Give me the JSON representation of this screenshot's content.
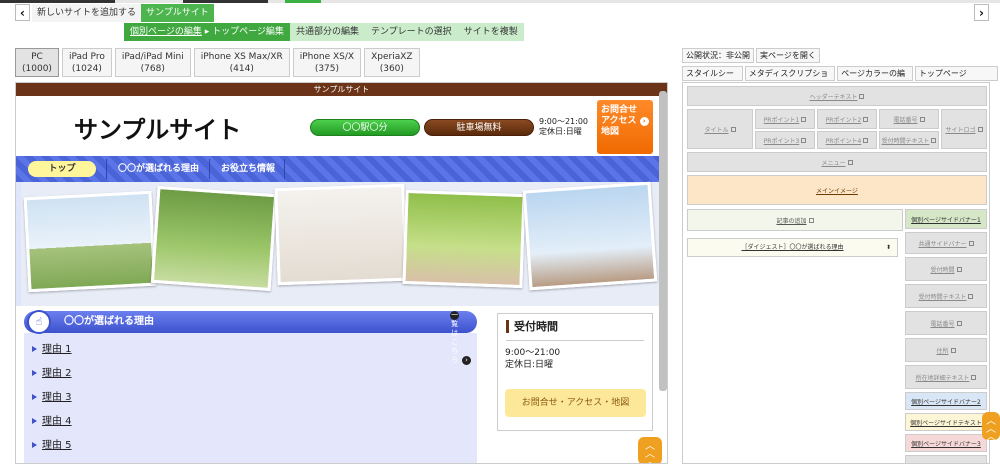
{
  "toolbar": {
    "prev_icon": "chevron-left-icon",
    "next_icon": "chevron-right-icon",
    "add_site": "新しいサイトを追加する",
    "current_site": "サンプルサイト"
  },
  "subnav": {
    "breadcrumb_page_edit": "個別ページの編集",
    "breadcrumb_current": "トップページ編集",
    "items": [
      "共通部分の編集",
      "テンプレートの選択",
      "サイトを複製"
    ]
  },
  "devices": [
    {
      "name": "PC",
      "width": "(1000)"
    },
    {
      "name": "iPad Pro",
      "width": "(1024)"
    },
    {
      "name": "iPad/iPad Mini",
      "width": "(768)"
    },
    {
      "name": "iPhone XS Max/XR",
      "width": "(414)"
    },
    {
      "name": "iPhone XS/X",
      "width": "(375)"
    },
    {
      "name": "XperiaXZ",
      "width": "(360)"
    }
  ],
  "preview": {
    "site_bar": "サンプルサイト",
    "site_title": "サンプルサイト",
    "station_pill": "〇〇駅〇分",
    "parking_pill": "駐車場無料",
    "hours_line1": "9:00〜21:00",
    "hours_line2": "定休日:日曜",
    "contact_line1": "お問合せ",
    "contact_line2": "アクセス",
    "contact_line3": "地図",
    "menu": [
      "トップ",
      "〇〇が選ばれる理由",
      "お役立ち情報"
    ],
    "section_title": "〇〇が選ばれる理由",
    "section_more": "一覧はこちら",
    "reasons": [
      "理由 1",
      "理由 2",
      "理由 3",
      "理由 4",
      "理由 5"
    ],
    "side_title": "受付時間",
    "side_hours1": "9:00〜21:00",
    "side_hours2": "定休日:日曜",
    "side_button": "お問合せ・アクセス・地図",
    "colors": {
      "brand_brown": "#6b3418",
      "menu_blue": "#4a63d6",
      "green": "#3cb043",
      "orange": "#f06a00"
    }
  },
  "right": {
    "status": "公開状況：非公開",
    "open_page": "実ページを開く",
    "tools": [
      "スタイルシート",
      "メタディスクリプション",
      "ページカラーの編集",
      "トップページnoindex"
    ],
    "layout": {
      "header_text": "ヘッダーテキスト",
      "title": "タイトル",
      "pr1": "PRポイント1",
      "pr2": "PRポイント2",
      "pr3": "PRポイント3",
      "pr4": "PRポイント4",
      "phone": "電話番号",
      "hours_text": "受付時間テキスト",
      "site_logo": "サイトロゴ",
      "menu": "メニュー",
      "main_image": "メインイメージ",
      "add_article": "記事の追加",
      "digest": "［ダイジェスト］〇〇が選ばれる理由",
      "side": [
        "個別ページサイドバナー1",
        "共通サイドバナー",
        "受付時間",
        "受付時間テキスト",
        "電話番号",
        "住所",
        "所在地詳細テキスト",
        "個別ページサイドバナー2",
        "個別ページサイドテキスト",
        "個別ページサイドバナー3"
      ]
    }
  }
}
